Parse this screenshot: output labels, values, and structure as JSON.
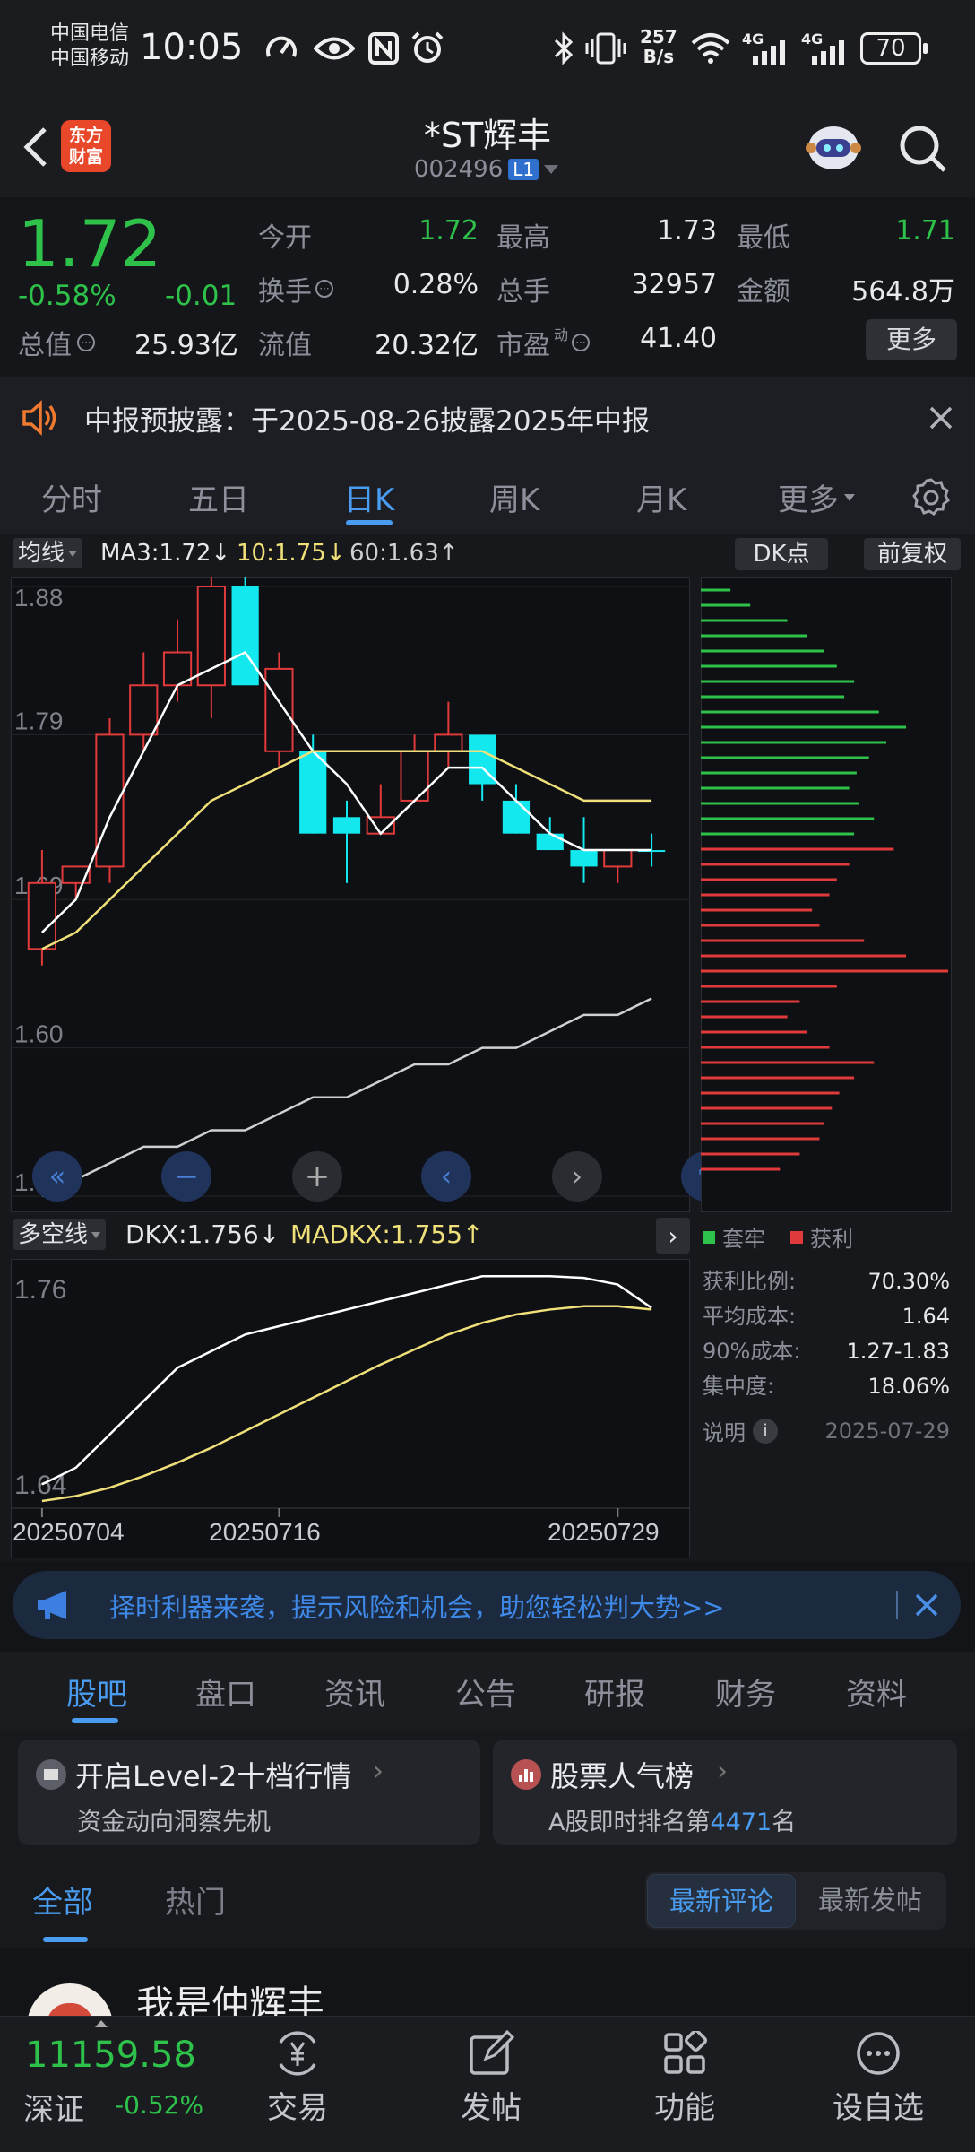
{
  "status": {
    "carrier1": "中国电信",
    "carrier2": "中国移动",
    "time": "10:05",
    "net_speed_top": "257",
    "net_speed_bottom": "B/s",
    "net1": "4G",
    "net2": "4G",
    "battery": "70"
  },
  "header": {
    "logo_line1": "东方",
    "logo_line2": "财富",
    "stock_name": "*ST辉丰",
    "stock_code": "002496",
    "level_badge": "L1"
  },
  "quote": {
    "price": "1.72",
    "change_pct": "-0.58%",
    "change": "-0.01",
    "open_label": "今开",
    "open": "1.72",
    "high_label": "最高",
    "high": "1.73",
    "low_label": "最低",
    "low": "1.71",
    "turnover_label": "换手",
    "turnover": "0.28%",
    "volume_label": "总手",
    "volume": "32957",
    "amount_label": "金额",
    "amount": "564.8万",
    "mktcap_label": "总值",
    "mktcap": "25.93亿",
    "float_label": "流值",
    "float": "20.32亿",
    "pe_label": "市盈",
    "pe_sup": "动",
    "pe": "41.40",
    "more": "更多"
  },
  "notice": {
    "text": "中报预披露：于2025-08-26披露2025年中报"
  },
  "tabs": [
    "分时",
    "五日",
    "日K",
    "周K",
    "月K",
    "更多"
  ],
  "active_tab": 2,
  "chart_toolbar": {
    "ma_select": "均线",
    "ma3": "MA3:1.72↓",
    "ma10": "10:1.75↓",
    "ma60": "60:1.63↑",
    "dk_button": "DK点",
    "adjust_button": "前复权"
  },
  "chart_data": [
    {
      "type": "candlestick",
      "title": "",
      "y_ticks": [
        "1.88",
        "1.79",
        "1.69",
        "1.60",
        "1.51"
      ],
      "ylim": [
        1.51,
        1.88
      ],
      "candles": [
        {
          "o": 1.66,
          "h": 1.72,
          "l": 1.65,
          "c": 1.7,
          "dir": "up"
        },
        {
          "o": 1.7,
          "h": 1.71,
          "l": 1.69,
          "c": 1.71,
          "dir": "up"
        },
        {
          "o": 1.71,
          "h": 1.8,
          "l": 1.7,
          "c": 1.79,
          "dir": "up"
        },
        {
          "o": 1.79,
          "h": 1.84,
          "l": 1.78,
          "c": 1.82,
          "dir": "up"
        },
        {
          "o": 1.82,
          "h": 1.86,
          "l": 1.81,
          "c": 1.84,
          "dir": "up"
        },
        {
          "o": 1.82,
          "h": 1.89,
          "l": 1.8,
          "c": 1.88,
          "dir": "up"
        },
        {
          "o": 1.88,
          "h": 1.89,
          "l": 1.82,
          "c": 1.82,
          "dir": "down"
        },
        {
          "o": 1.78,
          "h": 1.84,
          "l": 1.77,
          "c": 1.83,
          "dir": "up"
        },
        {
          "o": 1.78,
          "h": 1.79,
          "l": 1.73,
          "c": 1.73,
          "dir": "down"
        },
        {
          "o": 1.74,
          "h": 1.75,
          "l": 1.7,
          "c": 1.73,
          "dir": "down"
        },
        {
          "o": 1.73,
          "h": 1.76,
          "l": 1.73,
          "c": 1.74,
          "dir": "up"
        },
        {
          "o": 1.75,
          "h": 1.79,
          "l": 1.75,
          "c": 1.78,
          "dir": "up"
        },
        {
          "o": 1.78,
          "h": 1.81,
          "l": 1.77,
          "c": 1.79,
          "dir": "up"
        },
        {
          "o": 1.79,
          "h": 1.79,
          "l": 1.75,
          "c": 1.76,
          "dir": "down"
        },
        {
          "o": 1.75,
          "h": 1.76,
          "l": 1.73,
          "c": 1.73,
          "dir": "down"
        },
        {
          "o": 1.73,
          "h": 1.74,
          "l": 1.72,
          "c": 1.72,
          "dir": "down"
        },
        {
          "o": 1.72,
          "h": 1.74,
          "l": 1.7,
          "c": 1.71,
          "dir": "down"
        },
        {
          "o": 1.71,
          "h": 1.72,
          "l": 1.7,
          "c": 1.72,
          "dir": "up"
        },
        {
          "o": 1.72,
          "h": 1.73,
          "l": 1.71,
          "c": 1.72,
          "dir": "down"
        }
      ],
      "series": [
        {
          "name": "MA3",
          "color": "#ffffff",
          "values": [
            1.67,
            1.69,
            1.74,
            1.78,
            1.82,
            1.83,
            1.84,
            1.81,
            1.78,
            1.76,
            1.73,
            1.75,
            1.77,
            1.77,
            1.75,
            1.73,
            1.72,
            1.72,
            1.72
          ]
        },
        {
          "name": "10",
          "color": "#f0e07a",
          "values": [
            1.66,
            1.67,
            1.69,
            1.71,
            1.73,
            1.75,
            1.76,
            1.77,
            1.78,
            1.78,
            1.78,
            1.78,
            1.78,
            1.78,
            1.77,
            1.76,
            1.75,
            1.75,
            1.75
          ]
        },
        {
          "name": "60",
          "color": "#cfd0d4",
          "values": [
            1.51,
            1.52,
            1.53,
            1.54,
            1.54,
            1.55,
            1.55,
            1.56,
            1.57,
            1.57,
            1.58,
            1.59,
            1.59,
            1.6,
            1.6,
            1.61,
            1.62,
            1.62,
            1.63
          ]
        }
      ]
    },
    {
      "type": "line",
      "title": "",
      "y_ticks": [
        "1.76",
        "1.64"
      ],
      "ylim": [
        1.64,
        1.78
      ],
      "x_ticks": [
        "20250704",
        "20250716",
        "20250729"
      ],
      "series": [
        {
          "name": "DKX",
          "color": "#ffffff",
          "values": [
            1.65,
            1.66,
            1.68,
            1.7,
            1.72,
            1.73,
            1.74,
            1.745,
            1.75,
            1.755,
            1.76,
            1.765,
            1.77,
            1.775,
            1.775,
            1.775,
            1.774,
            1.77,
            1.756
          ]
        },
        {
          "name": "MADKX",
          "color": "#f0e07a",
          "values": [
            1.64,
            1.643,
            1.648,
            1.655,
            1.663,
            1.672,
            1.682,
            1.692,
            1.702,
            1.712,
            1.722,
            1.731,
            1.74,
            1.747,
            1.752,
            1.755,
            1.757,
            1.757,
            1.755
          ]
        }
      ]
    }
  ],
  "chip_dist": {
    "legend_trap": "套牢",
    "legend_profit": "获利",
    "profit_ratio_label": "获利比例:",
    "profit_ratio": "70.30%",
    "avg_cost_label": "平均成本:",
    "avg_cost": "1.64",
    "cost90_label": "90%成本:",
    "cost90": "1.27-1.83",
    "concentration_label": "集中度:",
    "concentration": "18.06%",
    "note_label": "说明",
    "date": "2025-07-29",
    "green_bars": [
      0.12,
      0.2,
      0.35,
      0.43,
      0.5,
      0.55,
      0.62,
      0.58,
      0.72,
      0.83,
      0.75,
      0.68,
      0.63,
      0.6,
      0.64,
      0.7,
      0.62
    ],
    "red_bars": [
      0.78,
      0.6,
      0.55,
      0.52,
      0.45,
      0.48,
      0.66,
      0.83,
      1.0,
      0.55,
      0.4,
      0.35,
      0.43,
      0.52,
      0.7,
      0.62,
      0.56,
      0.53,
      0.5,
      0.48,
      0.4,
      0.32
    ]
  },
  "indicator_toolbar": {
    "select": "多空线",
    "dkx": "DKX:1.756↓",
    "madkx": "MADKX:1.755↑"
  },
  "banner": {
    "text": "择时利器来袭，提示风险和机会，助您轻松判大势>>"
  },
  "subtabs": [
    "股吧",
    "盘口",
    "资讯",
    "公告",
    "研报",
    "财务",
    "资料"
  ],
  "active_subtab": 0,
  "cards": {
    "left_title": "开启Level-2十档行情",
    "left_sub": "资金动向洞察先机",
    "right_title": "股票人气榜",
    "right_sub_prefix": "A股即时排名第",
    "right_rank": "4471",
    "right_sub_suffix": "名"
  },
  "filter": {
    "all": "全部",
    "hot": "热门",
    "latest_comment": "最新评论",
    "latest_post": "最新发帖"
  },
  "post": {
    "author": "我是仲辉丰"
  },
  "bottom_nav": {
    "index_value": "11159.58",
    "index_name": "深证",
    "index_change": "-0.52%",
    "items": [
      "交易",
      "发帖",
      "功能",
      "设自选"
    ]
  }
}
